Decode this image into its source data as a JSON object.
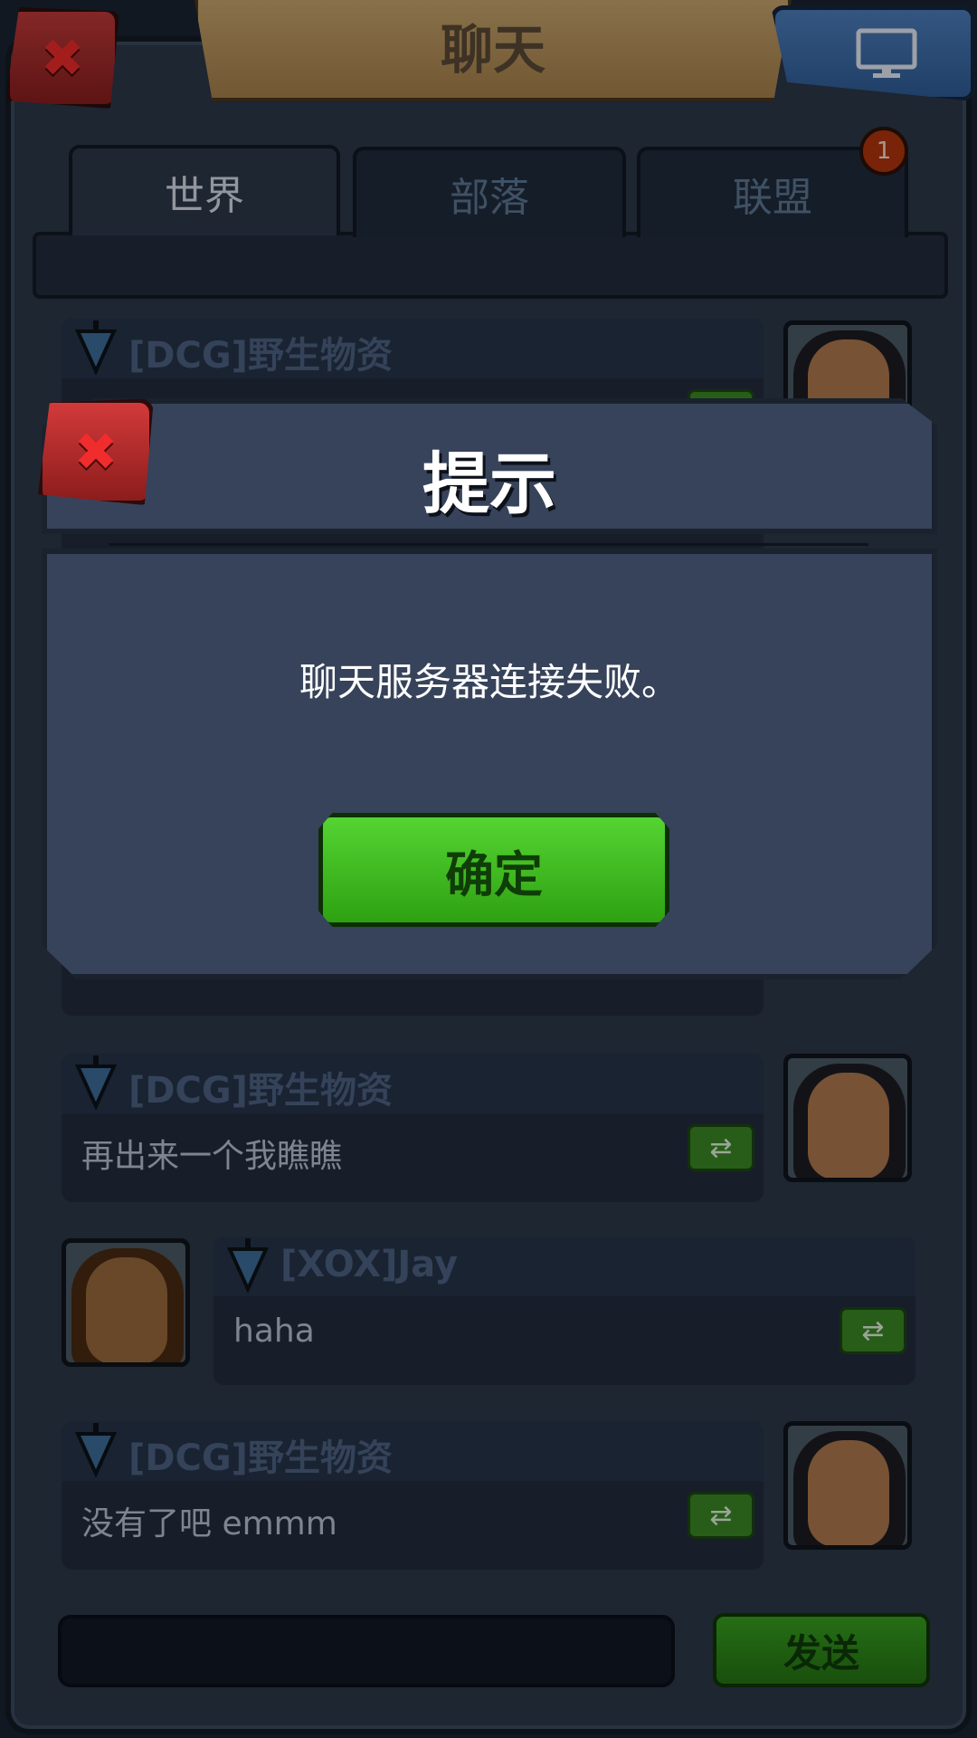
{
  "header": {
    "title": "聊天"
  },
  "tabs": [
    {
      "label": "世界",
      "active": true
    },
    {
      "label": "部落",
      "active": false
    },
    {
      "label": "联盟",
      "active": false
    }
  ],
  "alliance_badge": "1",
  "messages": [
    {
      "name": "[DCG]野生物资",
      "text": "",
      "side": "right"
    },
    {
      "name": "[DCG]野生物资",
      "text": "再出来一个我瞧瞧",
      "side": "right"
    },
    {
      "name": "[XOX]Jay",
      "text": "haha",
      "side": "left"
    },
    {
      "name": "[DCG]野生物资",
      "text": "没有了吧   emmm",
      "side": "right"
    }
  ],
  "input": {
    "value": ""
  },
  "send_label": "发送",
  "dialog": {
    "title": "提示",
    "message": "聊天服务器连接失败。",
    "ok_label": "确定"
  },
  "colors": {
    "accent_green": "#38a31f",
    "close_red": "#c23a3a",
    "screen_blue": "#4d7fbd",
    "badge": "#b3360e"
  },
  "icons": {
    "close": "close-icon",
    "screen": "monitor-icon",
    "share": "share-icon",
    "pin": "banner-icon"
  }
}
